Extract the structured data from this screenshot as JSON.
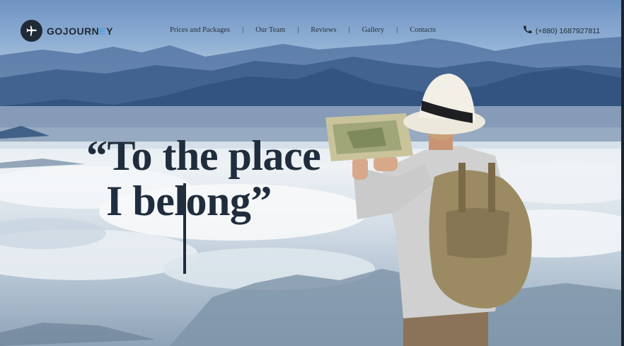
{
  "brand": {
    "name_main": "GOJOURN",
    "name_accent": "E",
    "name_tail": "Y"
  },
  "nav": {
    "items": [
      "Prices and Packages",
      "Our Team",
      "Reviews",
      "Gallery",
      "Contacts"
    ],
    "separator": "|"
  },
  "contact": {
    "phone": "(+880) 1687927811"
  },
  "hero": {
    "line1": "“To the place",
    "line2": "I belong”"
  },
  "colors": {
    "accent": "#4fa0e6",
    "text": "#1f2d3d",
    "sky": "#6f93c2"
  },
  "icons": {
    "logo": "airplane-icon",
    "phone": "phone-icon"
  }
}
